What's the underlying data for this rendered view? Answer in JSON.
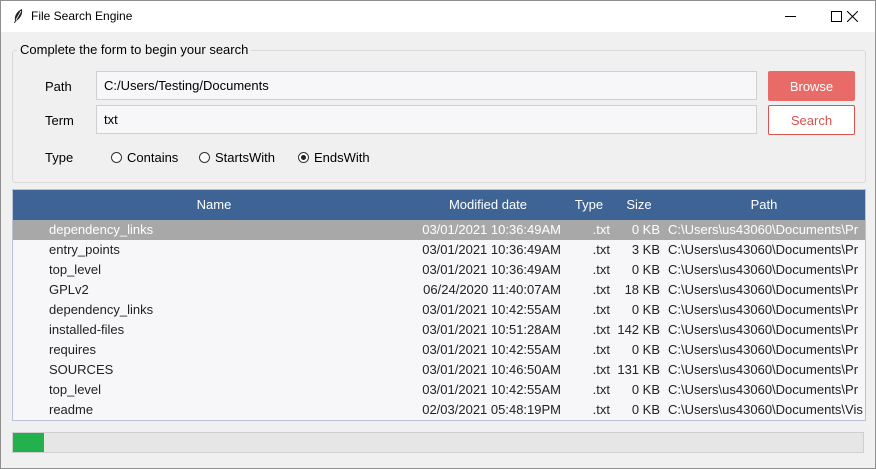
{
  "window": {
    "title": "File Search Engine"
  },
  "form": {
    "group_label": "Complete the form to begin your search",
    "path_label": "Path",
    "path_value": "C:/Users/Testing/Documents",
    "term_label": "Term",
    "term_value": "txt",
    "type_label": "Type",
    "browse_label": "Browse",
    "search_label": "Search",
    "options": [
      "Contains",
      "StartsWith",
      "EndsWith"
    ],
    "selected_option": "EndsWith"
  },
  "table": {
    "columns": [
      "Name",
      "Modified date",
      "Type",
      "Size",
      "Path"
    ],
    "selected_row": 0,
    "rows": [
      {
        "name": "dependency_links",
        "date": "03/01/2021 10:36:49AM",
        "type": ".txt",
        "size": "0 KB",
        "path": "C:\\Users\\us43060\\Documents\\Pr"
      },
      {
        "name": "entry_points",
        "date": "03/01/2021 10:36:49AM",
        "type": ".txt",
        "size": "3 KB",
        "path": "C:\\Users\\us43060\\Documents\\Pr"
      },
      {
        "name": "top_level",
        "date": "03/01/2021 10:36:49AM",
        "type": ".txt",
        "size": "0 KB",
        "path": "C:\\Users\\us43060\\Documents\\Pr"
      },
      {
        "name": "GPLv2",
        "date": "06/24/2020 11:40:07AM",
        "type": ".txt",
        "size": "18 KB",
        "path": "C:\\Users\\us43060\\Documents\\Pr"
      },
      {
        "name": "dependency_links",
        "date": "03/01/2021 10:42:55AM",
        "type": ".txt",
        "size": "0 KB",
        "path": "C:\\Users\\us43060\\Documents\\Pr"
      },
      {
        "name": "installed-files",
        "date": "03/01/2021 10:51:28AM",
        "type": ".txt",
        "size": "142 KB",
        "path": "C:\\Users\\us43060\\Documents\\Pr"
      },
      {
        "name": "requires",
        "date": "03/01/2021 10:42:55AM",
        "type": ".txt",
        "size": "0 KB",
        "path": "C:\\Users\\us43060\\Documents\\Pr"
      },
      {
        "name": "SOURCES",
        "date": "03/01/2021 10:46:50AM",
        "type": ".txt",
        "size": "131 KB",
        "path": "C:\\Users\\us43060\\Documents\\Pr"
      },
      {
        "name": "top_level",
        "date": "03/01/2021 10:42:55AM",
        "type": ".txt",
        "size": "0 KB",
        "path": "C:\\Users\\us43060\\Documents\\Pr"
      },
      {
        "name": "readme",
        "date": "02/03/2021 05:48:19PM",
        "type": ".txt",
        "size": "0 KB",
        "path": "C:\\Users\\us43060\\Documents\\Vis"
      }
    ]
  },
  "progress": {
    "fraction": 0.037
  },
  "colors": {
    "header_bg": "#3d6494",
    "browse_bg": "#e96b68",
    "search_border": "#d9534f",
    "progress_fill": "#22b14c",
    "selected_row_bg": "#a8a8a8"
  },
  "icons": {
    "app": "feather-icon",
    "minimize": "minimize-icon",
    "maximize": "maximize-icon",
    "close": "close-icon"
  }
}
